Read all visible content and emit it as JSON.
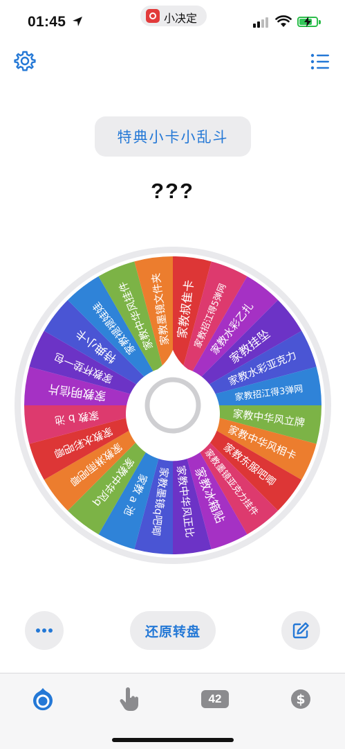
{
  "status": {
    "time": "01:45",
    "app_pill_label": "小决定",
    "battery_color": "#32c759"
  },
  "toolbar": {
    "settings_icon": "gear-icon",
    "list_icon": "list-icon",
    "accent_color": "#2478d6"
  },
  "title_button_label": "特典小卡小乱斗",
  "result_text": "???",
  "wheel": {
    "segments": [
      {
        "label": "家教叔隹卡",
        "color": "#dd3636"
      },
      {
        "label": "家教招江得5弹网",
        "color": "#dd3a6e"
      },
      {
        "label": "家教水彩乙扎",
        "color": "#a531c4"
      },
      {
        "label": "家教挂坠",
        "color": "#6c33c6"
      },
      {
        "label": "家教水彩亚克力",
        "color": "#4a55d4"
      },
      {
        "label": "家教招江得3弹网",
        "color": "#2f83d8"
      },
      {
        "label": "家教中华风立牌",
        "color": "#7cb346"
      },
      {
        "label": "家教中华风相卡",
        "color": "#ec7d2e"
      },
      {
        "label": "家教东服吧唧",
        "color": "#dd3636"
      },
      {
        "label": "家教墨镜亚克力挂件",
        "color": "#dd3a6e"
      },
      {
        "label": "家教冰箱贴",
        "color": "#a531c4"
      },
      {
        "label": "家教中华风正比",
        "color": "#6c33c6"
      },
      {
        "label": "家教墨镜q吧唧",
        "color": "#4a55d4"
      },
      {
        "label": "家教 a 池",
        "color": "#2f83d8"
      },
      {
        "label": "家教中华风q",
        "color": "#7cb346"
      },
      {
        "label": "家教淋雨吧唧",
        "color": "#ec7d2e"
      },
      {
        "label": "家教水彩吧唧",
        "color": "#dd3636"
      },
      {
        "label": "家教 b 池",
        "color": "#dd3a6e"
      },
      {
        "label": "家教明信片",
        "color": "#a531c4"
      },
      {
        "label": "家教杯垫一包",
        "color": "#6c33c6"
      },
      {
        "label": "特典小卡",
        "color": "#4a55d4"
      },
      {
        "label": "家教褪褪娃娃",
        "color": "#2f83d8"
      },
      {
        "label": "家教中华风挂件",
        "color": "#7cb346"
      },
      {
        "label": "家教墨镜文件夹",
        "color": "#ec7d2e"
      }
    ]
  },
  "actions": {
    "more_icon": "ellipsis-icon",
    "reset_label": "还原转盘",
    "edit_icon": "edit-icon"
  },
  "tabbar": {
    "tabs": [
      {
        "icon": "wheel-icon",
        "active": true
      },
      {
        "icon": "tap-hand-icon",
        "active": false
      },
      {
        "icon": "number-badge-icon",
        "badge": "42",
        "active": false
      },
      {
        "icon": "dollar-icon",
        "active": false
      }
    ]
  }
}
